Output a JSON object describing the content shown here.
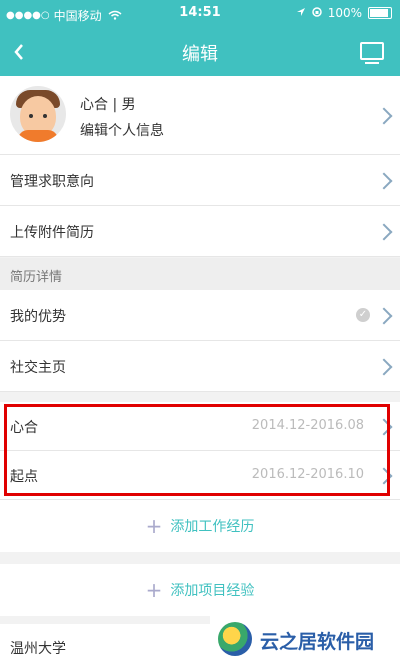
{
  "status_bar": {
    "signal_dots": "●●●●○",
    "carrier": "中国移动",
    "time": "14:51",
    "battery": "100%",
    "icons": [
      "wifi-icon",
      "location-icon",
      "lock-rotation-icon",
      "battery-icon"
    ]
  },
  "navbar": {
    "back_icon": "chevron-left-icon",
    "title": "编辑",
    "right_icon": "monitor-icon"
  },
  "profile": {
    "name_gender": "心合 | 男",
    "edit_label": "编辑个人信息"
  },
  "menu": {
    "job_intent": "管理求职意向",
    "upload_resume": "上传附件简历"
  },
  "section": {
    "resume_details": "简历详情"
  },
  "details": {
    "advantages": "我的优势",
    "social": "社交主页"
  },
  "work_experience": [
    {
      "company": "心合",
      "period": "2014.12-2016.08"
    },
    {
      "company": "起点",
      "period": "2016.12-2016.10"
    }
  ],
  "actions": {
    "add_work": "添加工作经历",
    "add_project": "添加项目经验"
  },
  "education": {
    "school": "温州大学"
  },
  "watermark": {
    "text": "云之居软件园"
  },
  "colors": {
    "accent": "#40c1c0",
    "highlight_border": "#e00000",
    "date_text": "#bbbbbb"
  }
}
